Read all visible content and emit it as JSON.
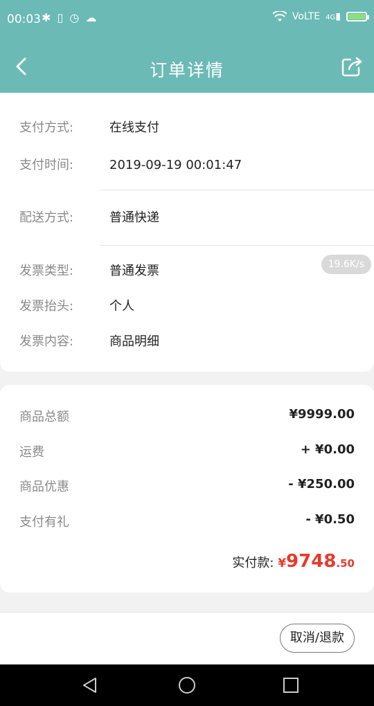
{
  "statusbar": {
    "time": "00:03",
    "left_icons": [
      "bluetooth-icon",
      "vibrate-icon",
      "alarm-icon",
      "wechat-icon"
    ],
    "right_icons": [
      "wifi-icon",
      "volte-icon",
      "signal-icon",
      "battery-icon"
    ],
    "volte": "VoLTE",
    "signal": "4G"
  },
  "header": {
    "title": "订单详情",
    "back_icon": "chevron-left-icon",
    "share_icon": "share-icon"
  },
  "order_info": {
    "payment_method_label": "支付方式:",
    "payment_method_value": "在线支付",
    "payment_time_label": "支付时间:",
    "payment_time_value": "2019-09-19 00:01:47",
    "shipping_label": "配送方式:",
    "shipping_value": "普通快递",
    "invoice_type_label": "发票类型:",
    "invoice_type_value": "普通发票",
    "invoice_title_label": "发票抬头:",
    "invoice_title_value": "个人",
    "invoice_content_label": "发票内容:",
    "invoice_content_value": "商品明细",
    "speed_badge": "19.6K/s"
  },
  "price": {
    "goods_total_label": "商品总额",
    "goods_total_value": "¥9999.00",
    "shipping_fee_label": "运费",
    "shipping_fee_value": "+ ¥0.00",
    "discount_label": "商品优惠",
    "discount_value": "- ¥250.00",
    "pay_gift_label": "支付有礼",
    "pay_gift_value": "- ¥0.50",
    "actual_label": "实付款:",
    "actual_currency": "¥",
    "actual_int": "9748",
    "actual_dec": ".50"
  },
  "actions": {
    "cancel_refund_label": "取消/退款"
  },
  "colors": {
    "theme": "#6bbab6",
    "price_red": "#e8392b"
  }
}
